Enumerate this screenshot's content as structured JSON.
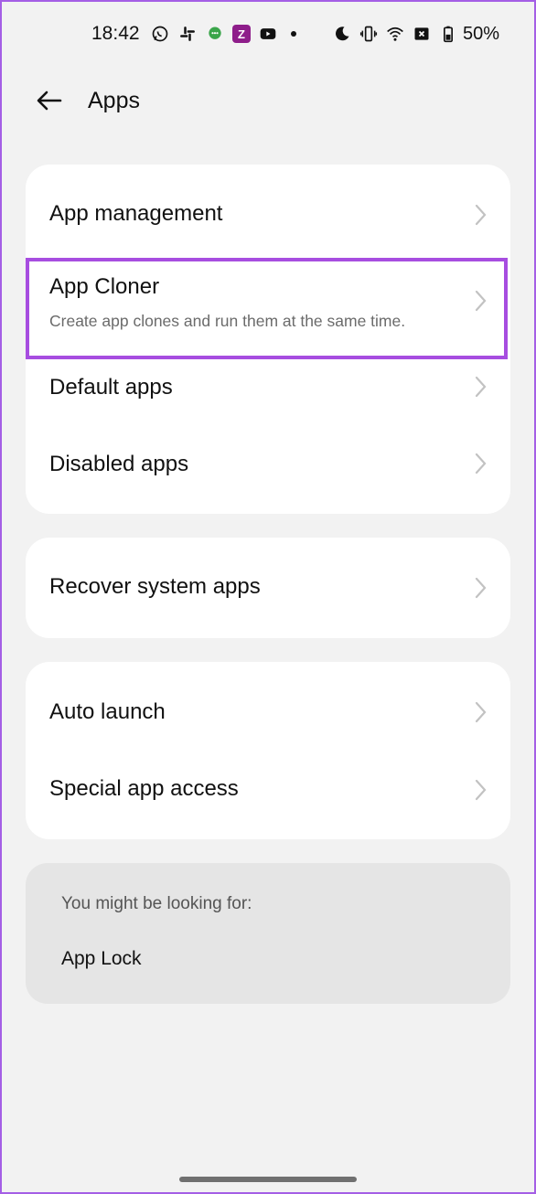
{
  "status_bar": {
    "time": "18:42",
    "battery_percent": "50%",
    "left_icons": [
      "whatsapp-icon",
      "slack-icon",
      "chat-icon",
      "z-app-icon",
      "youtube-icon",
      "dot-icon"
    ],
    "z_app_letter": "Z",
    "right_icons": [
      "moon-icon",
      "vibrate-icon",
      "wifi-icon",
      "sim-off-icon",
      "battery-icon"
    ]
  },
  "header": {
    "title": "Apps"
  },
  "groups": [
    {
      "items": [
        {
          "label": "App management"
        },
        {
          "label": "App Cloner",
          "subtitle": "Create app clones and run them at the same time."
        },
        {
          "label": "Default apps"
        },
        {
          "label": "Disabled apps"
        }
      ]
    },
    {
      "items": [
        {
          "label": "Recover system apps"
        }
      ]
    },
    {
      "items": [
        {
          "label": "Auto launch"
        },
        {
          "label": "Special app access"
        }
      ]
    }
  ],
  "suggestions": {
    "label": "You might be looking for:",
    "items": [
      "App Lock"
    ]
  },
  "colors": {
    "highlight": "#a74de0",
    "background": "#f2f2f2",
    "card": "#ffffff"
  }
}
